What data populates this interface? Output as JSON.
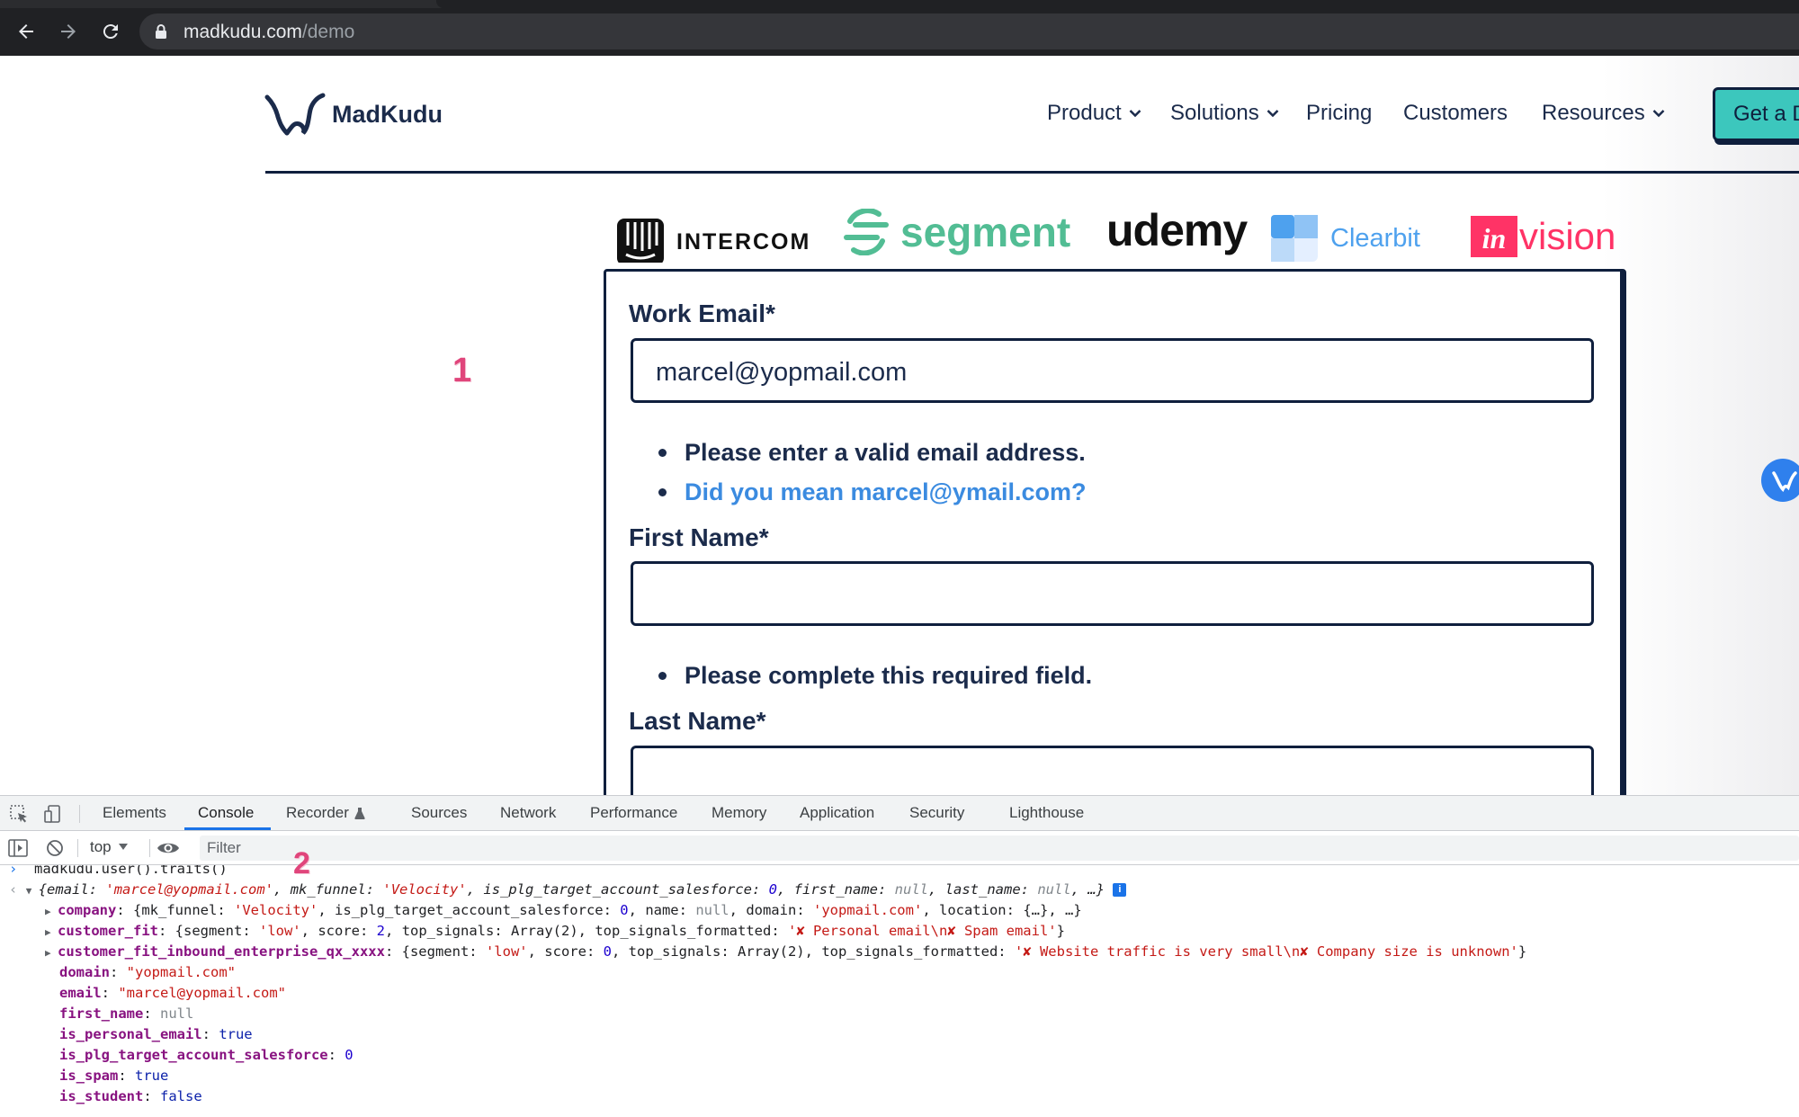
{
  "browser": {
    "url_host": "madkudu.com",
    "url_path": "/demo"
  },
  "site": {
    "brand": "MadKudu",
    "nav": [
      {
        "label": "Product",
        "has_dropdown": true
      },
      {
        "label": "Solutions",
        "has_dropdown": true
      },
      {
        "label": "Pricing",
        "has_dropdown": false
      },
      {
        "label": "Customers",
        "has_dropdown": false
      },
      {
        "label": "Resources",
        "has_dropdown": true
      }
    ],
    "cta_label": "Get a Demo"
  },
  "customer_logos": {
    "intercom": "INTERCOM",
    "segment": "segment",
    "udemy": "udemy",
    "clearbit": "Clearbit",
    "invision_badge": "in",
    "invision_rest": "vision"
  },
  "annotations": {
    "marker_1": "1",
    "marker_2": "2"
  },
  "form": {
    "email_label": "Work Email*",
    "email_value": "marcel@yopmail.com",
    "email_error": "Please enter a valid email address.",
    "email_suggestion": "Did you mean marcel@ymail.com?",
    "first_name_label": "First Name*",
    "first_name_value": "",
    "first_name_error": "Please complete this required field.",
    "last_name_label": "Last Name*",
    "last_name_value": ""
  },
  "devtools": {
    "tabs": [
      "Elements",
      "Console",
      "Recorder",
      "Sources",
      "Network",
      "Performance",
      "Memory",
      "Application",
      "Security",
      "Lighthouse"
    ],
    "active_tab": "Console",
    "context": "top",
    "filter_placeholder": "Filter",
    "console": {
      "command": "madkudu.user().traits()",
      "summary": {
        "open": "{",
        "email_key": "email",
        "email_val": "'marcel@yopmail.com'",
        "funnel_key": "mk_funnel",
        "funnel_val": "'Velocity'",
        "plg_key": "is_plg_target_account_salesforce",
        "plg_val": "0",
        "fn_key": "first_name",
        "fn_val": "null",
        "ln_key": "last_name",
        "ln_val": "null",
        "tail": "…}",
        "info": "i"
      },
      "company": {
        "key": "company",
        "k1": "mk_funnel",
        "v1": "'Velocity'",
        "k2": "is_plg_target_account_salesforce",
        "v2": "0",
        "k3": "name",
        "v3": "null",
        "k4": "domain",
        "v4": "'yopmail.com'",
        "k5": "location",
        "v5": "{…}",
        "tail": "…}"
      },
      "customer_fit": {
        "key": "customer_fit",
        "k1": "segment",
        "v1": "'low'",
        "k2": "score",
        "v2": "2",
        "k3": "top_signals",
        "v3": "Array(2)",
        "k4": "top_signals_formatted",
        "v4": "'✘ Personal email\\n✘ Spam email'"
      },
      "customer_fit_inbound": {
        "key": "customer_fit_inbound_enterprise_qx_xxxx",
        "k1": "segment",
        "v1": "'low'",
        "k2": "score",
        "v2": "0",
        "k3": "top_signals",
        "v3": "Array(2)",
        "k4": "top_signals_formatted",
        "v4": "'✘ Website traffic is very small\\n✘ Company size is unknown'"
      },
      "props": [
        {
          "key": "domain",
          "value": "\"yopmail.com\"",
          "type": "str"
        },
        {
          "key": "email",
          "value": "\"marcel@yopmail.com\"",
          "type": "str"
        },
        {
          "key": "first_name",
          "value": "null",
          "type": "nul"
        },
        {
          "key": "is_personal_email",
          "value": "true",
          "type": "bool"
        },
        {
          "key": "is_plg_target_account_salesforce",
          "value": "0",
          "type": "num"
        },
        {
          "key": "is_spam",
          "value": "true",
          "type": "bool"
        },
        {
          "key": "is_student",
          "value": "false",
          "type": "bool"
        }
      ]
    }
  },
  "colors": {
    "brand_navy": "#1b2b4b",
    "brand_teal": "#3cc7bd",
    "link_blue": "#3b8be0",
    "annotation_pink": "#e0457b"
  }
}
